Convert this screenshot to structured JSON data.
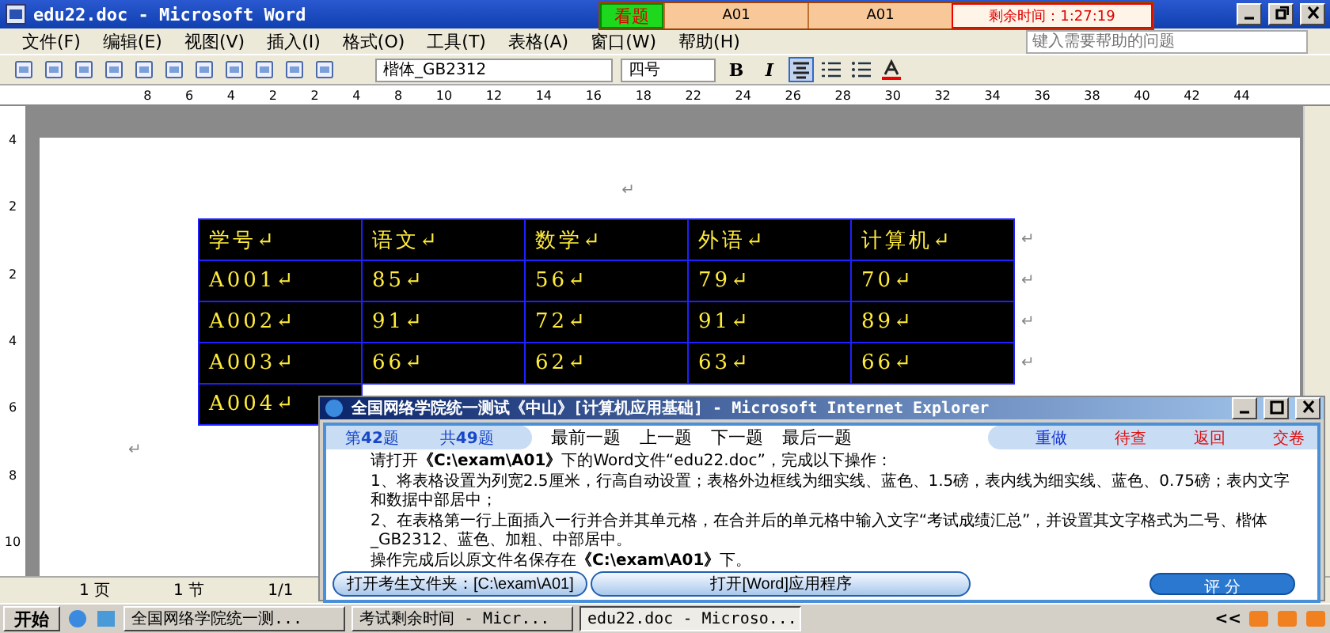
{
  "window": {
    "title": "edu22.doc - Microsoft Word"
  },
  "exam_bar": {
    "view_button": "看题",
    "fields": [
      "A01",
      "A01"
    ],
    "time_remaining": "剩余时间：1:27:19"
  },
  "menu": [
    "文件(F)",
    "编辑(E)",
    "视图(V)",
    "插入(I)",
    "格式(O)",
    "工具(T)",
    "表格(A)",
    "窗口(W)",
    "帮助(H)"
  ],
  "help_search": {
    "placeholder": "键入需要帮助的问题"
  },
  "toolbar": {
    "font": "楷体_GB2312",
    "size": "四号",
    "format_buttons": [
      {
        "label": "B",
        "selected": false
      },
      {
        "label": "I",
        "selected": false
      }
    ],
    "align_button": {
      "selected": true
    }
  },
  "ruler": [
    "8",
    "6",
    "4",
    "2",
    "2",
    "4",
    "8",
    "10",
    "12",
    "14",
    "16",
    "18",
    "22",
    "24",
    "26",
    "28",
    "30",
    "32",
    "34",
    "36",
    "38",
    "40",
    "42",
    "44"
  ],
  "vertical_ruler": [
    "4",
    "2",
    "2",
    "4",
    "6",
    "8",
    "10"
  ],
  "document": {
    "top_mark": "↵",
    "table": {
      "rows": [
        {
          "cells": [
            "学号↵",
            "语文↵",
            "数学↵",
            "外语↵",
            "计算机↵"
          ],
          "end_mark": "↵"
        },
        {
          "cells": [
            "A001↵",
            "85↵",
            "56↵",
            "79↵",
            "70↵"
          ],
          "end_mark": "↵"
        },
        {
          "cells": [
            "A002↵",
            "91↵",
            "72↵",
            "91↵",
            "89↵"
          ],
          "end_mark": "↵"
        },
        {
          "cells": [
            "A003↵",
            "66↵",
            "62↵",
            "63↵",
            "66↵"
          ],
          "end_mark": "↵"
        },
        {
          "cells": [
            "A004↵"
          ]
        }
      ]
    },
    "bottom_mark": "↵"
  },
  "status_bar": [
    "1 页",
    "1 节",
    "1/1"
  ],
  "exam_window": {
    "title": "全国网络学院统一测试《中山》[计算机应用基础] - Microsoft Internet Explorer",
    "counters": [
      "第**42**题",
      "共**49**题"
    ],
    "nav": [
      "最前一题",
      "上一题",
      "下一题",
      "最后一题"
    ],
    "actions": [
      {
        "label": "重做",
        "color": "#1030d0"
      },
      {
        "label": "待查",
        "color": "#e01010"
      },
      {
        "label": "返回",
        "color": "#e01010"
      },
      {
        "label": "交卷",
        "color": "#e01010"
      }
    ],
    "instructions": [
      "请打开**《C:\\exam\\A01》**下的Word文件“edu22.doc”，完成以下操作：",
      "1、将表格设置为列宽2.5厘米，行高自动设置；表格外边框线为细实线、蓝色、1.5磅，表内线为细实线、蓝色、0.75磅；表内文字和数据中部居中；",
      "2、在表格第一行上面插入一行并合并其单元格，在合并后的单元格中输入文字“考试成绩汇总”，并设置其文字格式为二号、楷体_GB2312、蓝色、加粗、中部居中。",
      "操作完成后以原文件名保存在**《C:\\exam\\A01》**下。"
    ],
    "buttons": [
      "打开考生文件夹：[C:\\exam\\A01]",
      "打开[Word]应用程序",
      "评 分"
    ]
  },
  "taskbar": {
    "start": "开始",
    "tasks": [
      {
        "label": "全国网络学院统一测...",
        "selected": false
      },
      {
        "label": "考试剩余时间 - Micr...",
        "selected": false
      },
      {
        "label": "edu22.doc - Microso...",
        "selected": true
      }
    ],
    "tray": "<<"
  }
}
